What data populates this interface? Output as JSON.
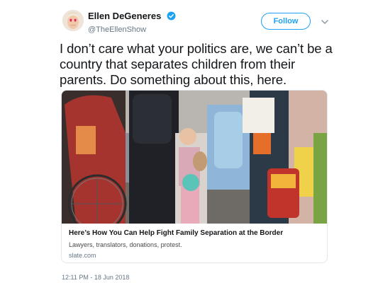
{
  "user": {
    "display_name": "Ellen DeGeneres",
    "handle": "@TheEllenShow"
  },
  "follow_label": "Follow",
  "tweet_text": "I don’t care what your politics are, we can’t be a country that separates children from their parents. Do something about this, here.",
  "card": {
    "title": "Here’s How You Can Help Fight Family Separation at the Border",
    "description": "Lawyers, translators, donations, protest.",
    "domain": "slate.com"
  },
  "timestamp": "12:11 PM - 18 Jun 2018",
  "colors": {
    "accent": "#1da1f2",
    "text": "#14171a",
    "muted": "#657786",
    "border": "#e1e8ed"
  },
  "icons": {
    "verified": "verified-badge-icon",
    "menu": "chevron-down-icon"
  }
}
